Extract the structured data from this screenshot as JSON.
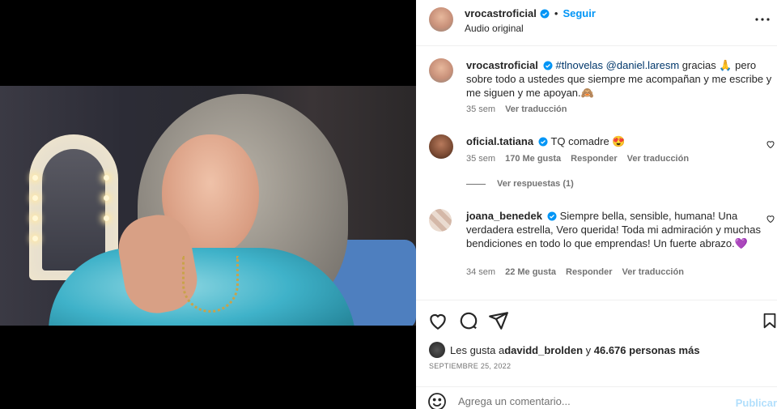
{
  "post": {
    "author": "vrocastroficial",
    "follow_label": "Seguir",
    "separator": "•",
    "audio_label": "Audio original"
  },
  "caption": {
    "username": "vrocastroficial",
    "hashtag": "#tlnovelas",
    "mention": "@daniel.laresm",
    "text_1": " gracias 🙏 pero sobre todo a ustedes que siempre me acompañan y me escribe y me siguen y me apoyan.🙈",
    "time": "35 sem",
    "translate": "Ver traducción"
  },
  "comments": [
    {
      "username": "oficial.tatiana",
      "text": "TQ comadre 😍",
      "time": "35 sem",
      "likes": "170 Me gusta",
      "reply": "Responder",
      "translate": "Ver traducción",
      "view_replies": "Ver respuestas (1)"
    },
    {
      "username": "joana_benedek",
      "text": "Siempre bella, sensible, humana! Una verdadera estrella, Vero querida! Toda mi admiración y muchas bendiciones en todo lo que emprendas! Un fuerte abrazo.💜",
      "time": "34 sem",
      "likes": "22 Me gusta",
      "reply": "Responder",
      "translate": "Ver traducción"
    }
  ],
  "likes": {
    "prefix": "Les gusta a ",
    "user": "davidd_brolden",
    "middle": " y ",
    "others": "46.676 personas más"
  },
  "date": "SEPTIEMBRE 25, 2022",
  "add_comment": {
    "placeholder": "Agrega un comentario...",
    "publish": "Publicar"
  },
  "icons": {
    "verified_color": "#0095f6",
    "like": "heart-icon",
    "comment": "comment-icon",
    "share": "share-icon",
    "save": "bookmark-icon",
    "emoji": "emoji-icon",
    "more": "more-options-icon",
    "mute": "muted-speaker-icon"
  }
}
